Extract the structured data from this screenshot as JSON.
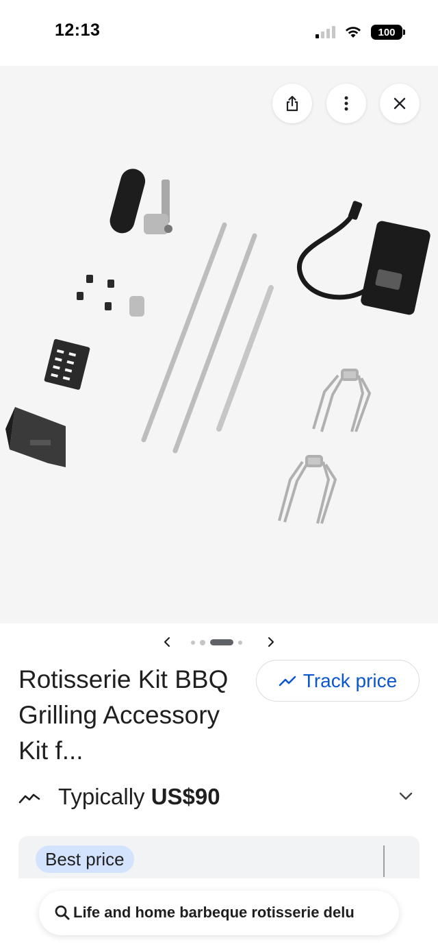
{
  "status_bar": {
    "time": "12:13",
    "battery": "100",
    "signal_bars_on": 1,
    "signal_bars_total": 4
  },
  "image_viewer": {
    "share_icon": "share-icon",
    "more_icon": "more-vertical-icon",
    "close_icon": "close-icon",
    "carousel": {
      "prev_icon": "chevron-left-icon",
      "next_icon": "chevron-right-icon",
      "dot_count": 5,
      "active_dot_index": 2
    }
  },
  "product": {
    "title": "Rotisserie Kit BBQ Grilling Accessory Kit f...",
    "track_label": "Track price",
    "price_prefix": "Typically",
    "price_value": "US$90",
    "best_price_label": "Best price"
  },
  "search": {
    "query": "Life and home barbeque rotisserie delu"
  },
  "colors": {
    "accent_blue": "#0b57d0",
    "chip_blue": "#d3e3fd",
    "image_bg": "#f5f5f5",
    "card_bg": "#f1f3f4"
  }
}
